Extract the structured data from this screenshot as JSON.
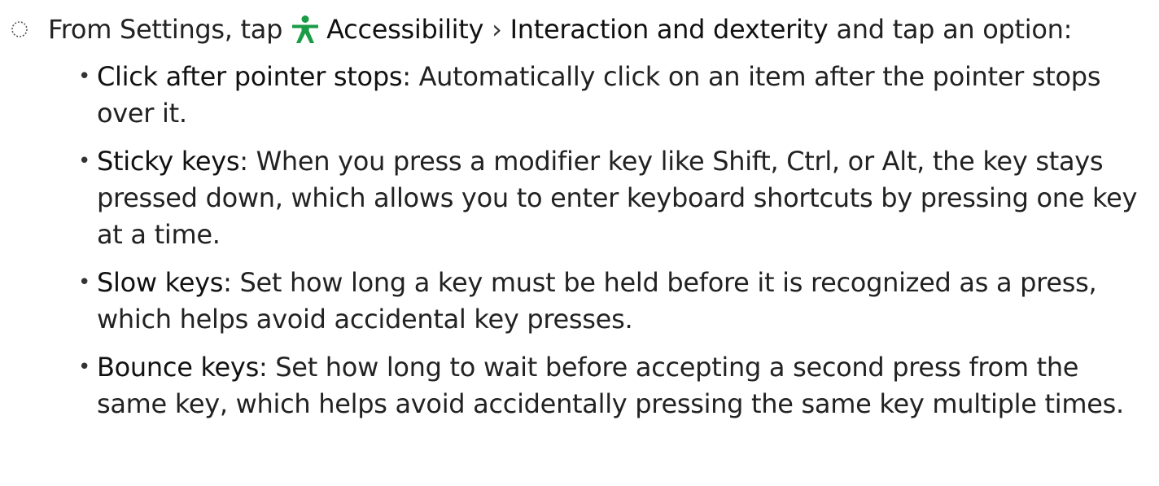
{
  "step": {
    "marker_icon": "dotted-circle-icon",
    "prefix": "From Settings, tap",
    "settings_icon": "accessibility-person-icon",
    "settings_icon_color": "#1a9b45",
    "menu_accessibility": "Accessibility",
    "separator": "›",
    "menu_interaction": "Interaction and dexterity",
    "suffix": "and tap an option:"
  },
  "options": [
    {
      "term": "Click after pointer stops",
      "description": ": Automatically click on an item after the pointer stops over it."
    },
    {
      "term": "Sticky keys",
      "description": ": When you press a modifier key like Shift, Ctrl, or Alt, the key stays pressed down, which allows you to enter keyboard shortcuts by pressing one key at a time."
    },
    {
      "term": "Slow keys",
      "description": ": Set how long a key must be held before it is recognized as a press, which helps avoid accidental key presses."
    },
    {
      "term": "Bounce keys",
      "description": ": Set how long to wait before accepting a second press from the same key, which helps avoid accidentally pressing the same key multiple times."
    }
  ],
  "bullet_glyph": "•"
}
